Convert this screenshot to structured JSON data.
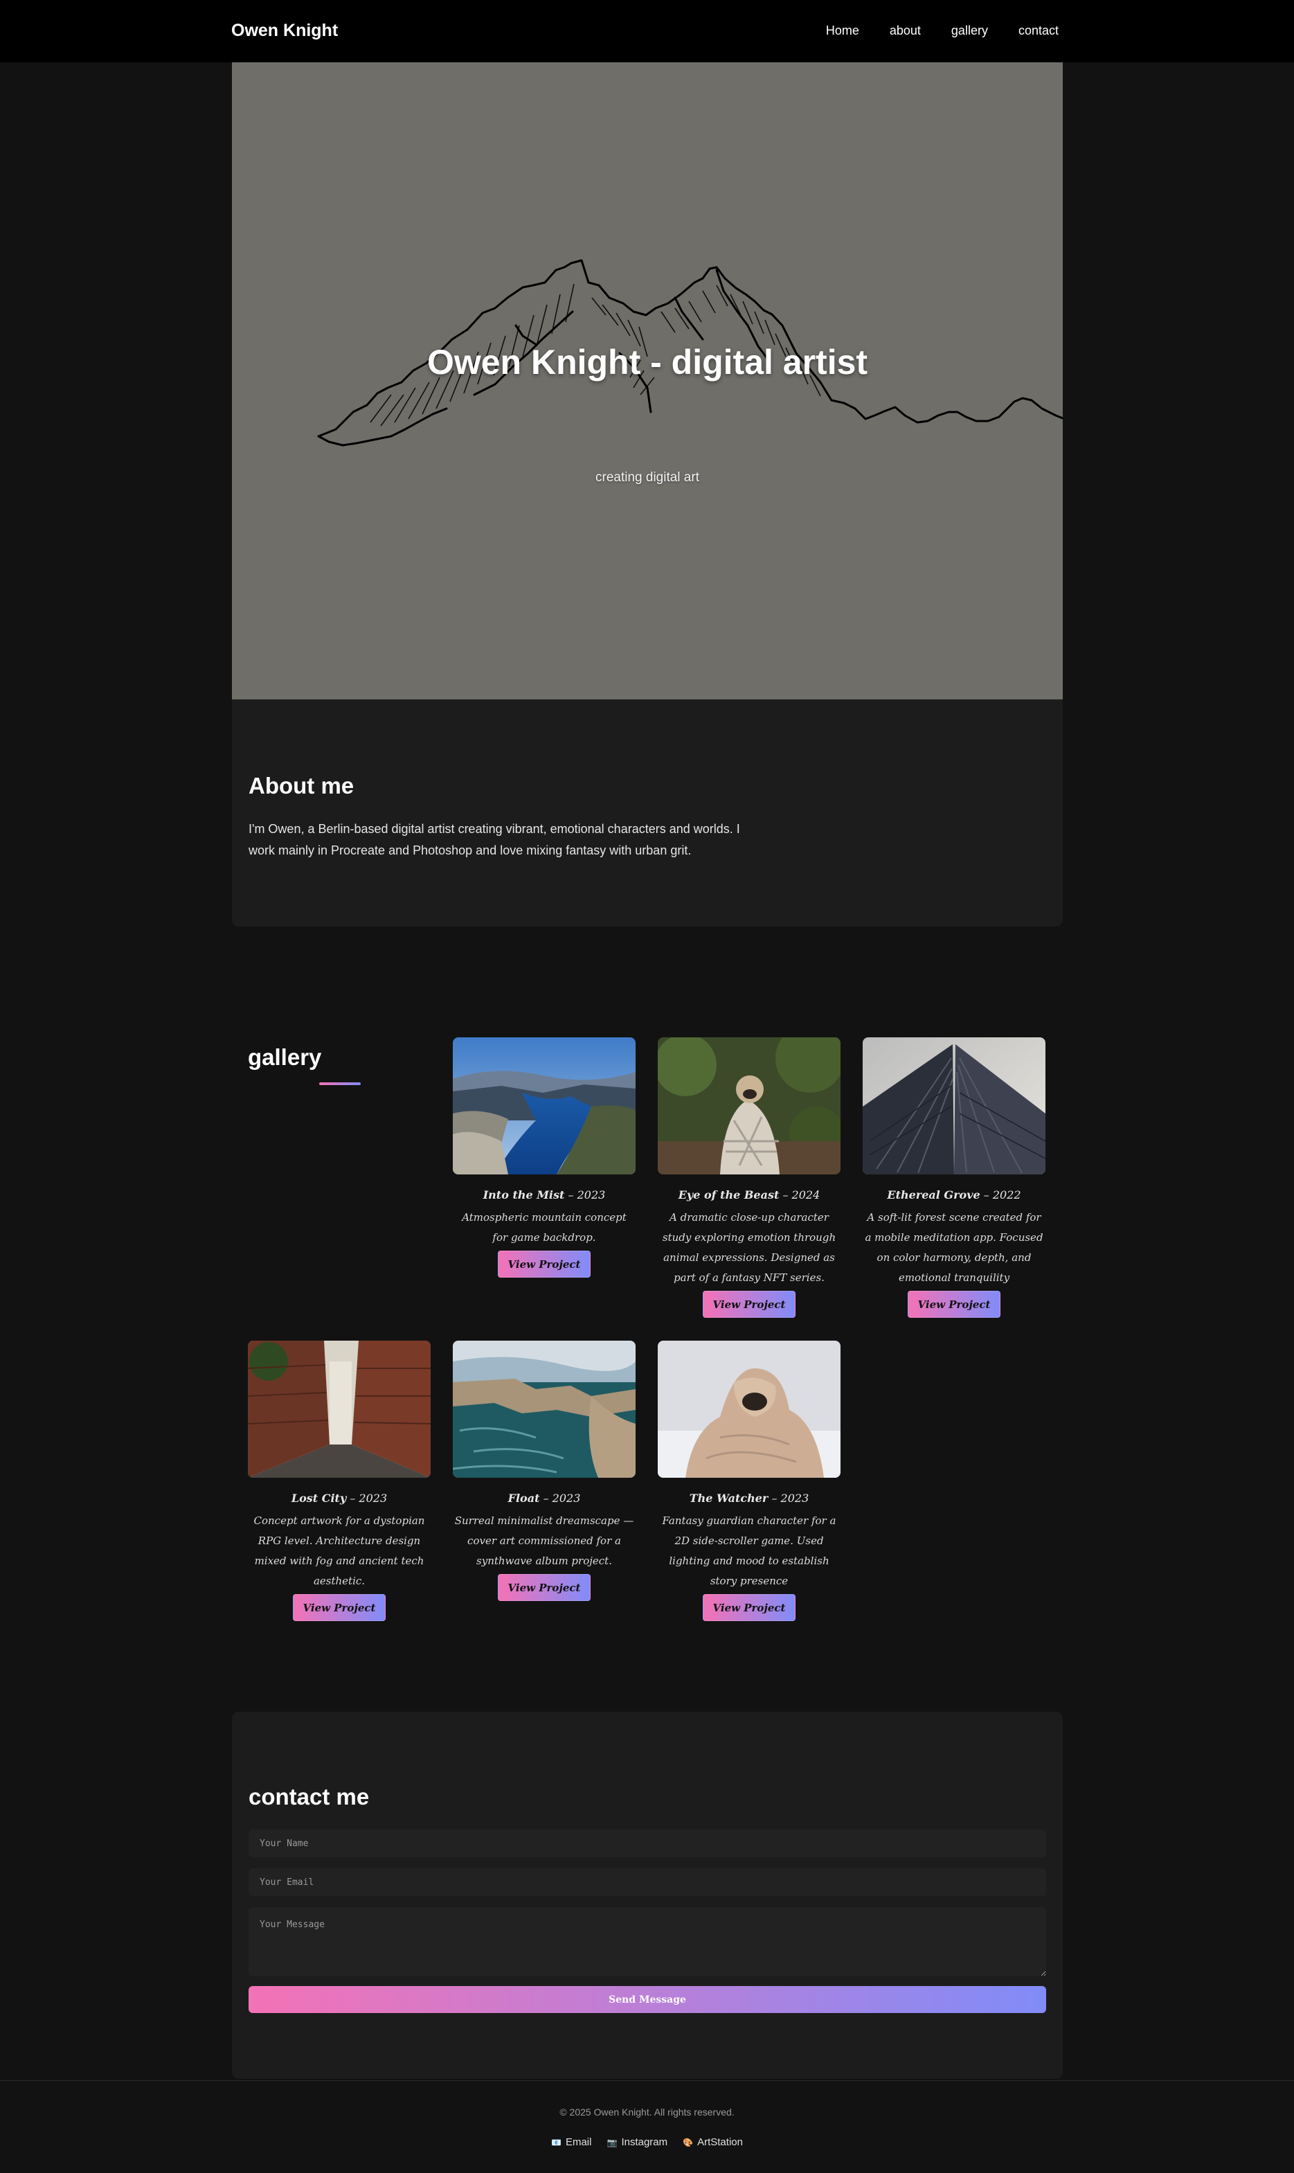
{
  "nav": {
    "brand": "Owen Knight",
    "links": [
      "Home",
      "about",
      "gallery",
      "contact"
    ]
  },
  "hero": {
    "title": "Owen Knight - digital artist",
    "subtitle": "creating digital art"
  },
  "about": {
    "heading": "About me",
    "text": "I'm Owen, a Berlin-based digital artist creating vibrant, emotional characters and worlds. I work mainly in Procreate and Photoshop and love mixing fantasy with urban grit."
  },
  "gallery": {
    "heading": "gallery",
    "items": [
      {
        "title": "Into the Mist",
        "year": "– 2023",
        "desc": "Atmospheric mountain concept for game backdrop.",
        "button": "View Project",
        "image": "fjord-landscape"
      },
      {
        "title": "Eye of the Beast",
        "year": "– 2024",
        "desc": "A dramatic close-up character study exploring emotion through animal expressions. Designed as part of a fantasy NFT series.",
        "button": "View Project",
        "image": "pug-blanket-forest"
      },
      {
        "title": "Ethereal Grove",
        "year": "– 2022",
        "desc": "A soft-lit forest scene created for a mobile meditation app. Focused on color harmony, depth, and emotional tranquility",
        "button": "View Project",
        "image": "skyscraper-upshot"
      },
      {
        "title": "Lost City",
        "year": "– 2023",
        "desc": "Concept artwork for a dystopian RPG level. Architecture design mixed with fog and ancient tech aesthetic.",
        "button": "View Project",
        "image": "brick-alley"
      },
      {
        "title": "Float",
        "year": "– 2023",
        "desc": "Surreal minimalist dreamscape — cover art commissioned for a synthwave album project.",
        "button": "View Project",
        "image": "coastal-cliffs"
      },
      {
        "title": "The Watcher",
        "year": "– 2023",
        "desc": "Fantasy guardian character for a 2D side-scroller game. Used lighting and mood to establish story presence",
        "button": "View Project",
        "image": "pug-blanket-bed"
      }
    ]
  },
  "contact": {
    "heading": "contact me",
    "name_placeholder": "Your Name",
    "email_placeholder": "Your Email",
    "message_placeholder": "Your Message",
    "send_label": "Send Message"
  },
  "footer": {
    "copyright": "© 2025 Owen Knight. All rights reserved.",
    "social": [
      {
        "label": "Email",
        "icon": "envelope-icon",
        "glyph": "📧"
      },
      {
        "label": "Instagram",
        "icon": "camera-icon",
        "glyph": "📷"
      },
      {
        "label": "ArtStation",
        "icon": "palette-icon",
        "glyph": "🎨"
      }
    ]
  },
  "colors": {
    "accent_start": "#f472b6",
    "accent_end": "#818cf8",
    "background": "#121212",
    "panel": "#1c1c1c",
    "hero": "#6f6e69"
  }
}
